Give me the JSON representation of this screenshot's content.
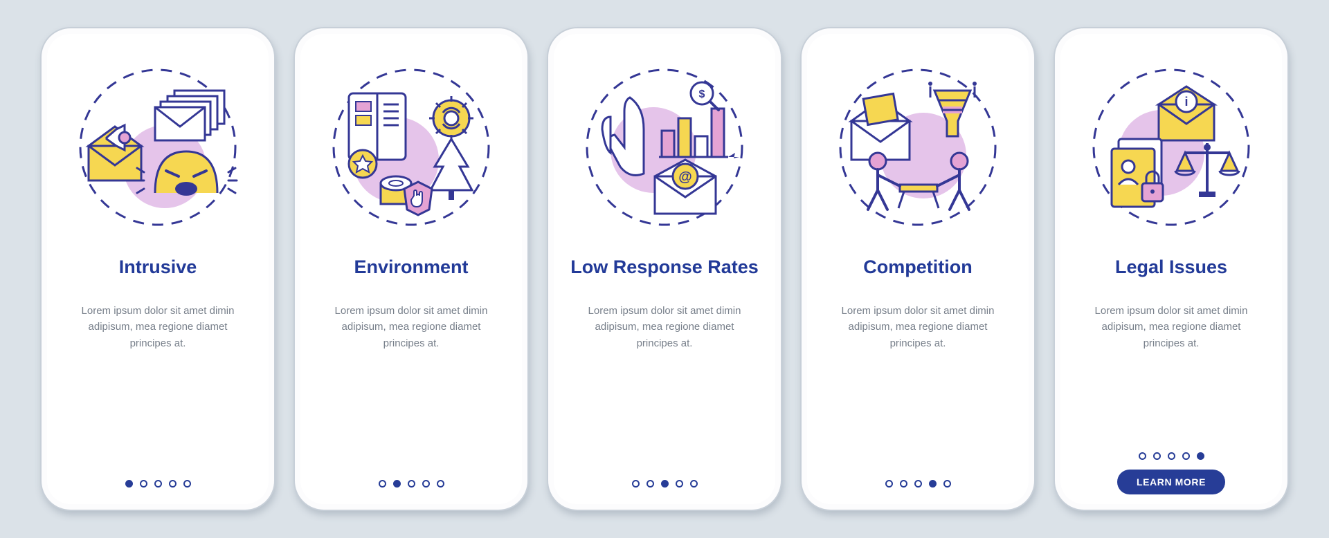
{
  "colors": {
    "stroke": "#343795",
    "yellow": "#f6d751",
    "pink": "#e4a3d4",
    "lilac": "#e5c4ea",
    "accent": "#273d97"
  },
  "cards": [
    {
      "title": "Intrusive",
      "desc": "Lorem ipsum dolor sit amet dimin adipisum, mea regione diamet principes at.",
      "icon_name": "intrusive-icon",
      "active_dot": 0,
      "has_button": false
    },
    {
      "title": "Environment",
      "desc": "Lorem ipsum dolor sit amet dimin adipisum, mea regione diamet principes at.",
      "icon_name": "environment-icon",
      "active_dot": 1,
      "has_button": false
    },
    {
      "title": "Low Response Rates",
      "desc": "Lorem ipsum dolor sit amet dimin adipisum, mea regione diamet principes at.",
      "icon_name": "low-response-icon",
      "active_dot": 2,
      "has_button": false
    },
    {
      "title": "Competition",
      "desc": "Lorem ipsum dolor sit amet dimin adipisum, mea regione diamet principes at.",
      "icon_name": "competition-icon",
      "active_dot": 3,
      "has_button": false
    },
    {
      "title": "Legal Issues",
      "desc": "Lorem ipsum dolor sit amet dimin adipisum, mea regione diamet principes at.",
      "icon_name": "legal-issues-icon",
      "active_dot": 4,
      "has_button": true
    }
  ],
  "button_label": "LEARN MORE",
  "dot_count": 5
}
